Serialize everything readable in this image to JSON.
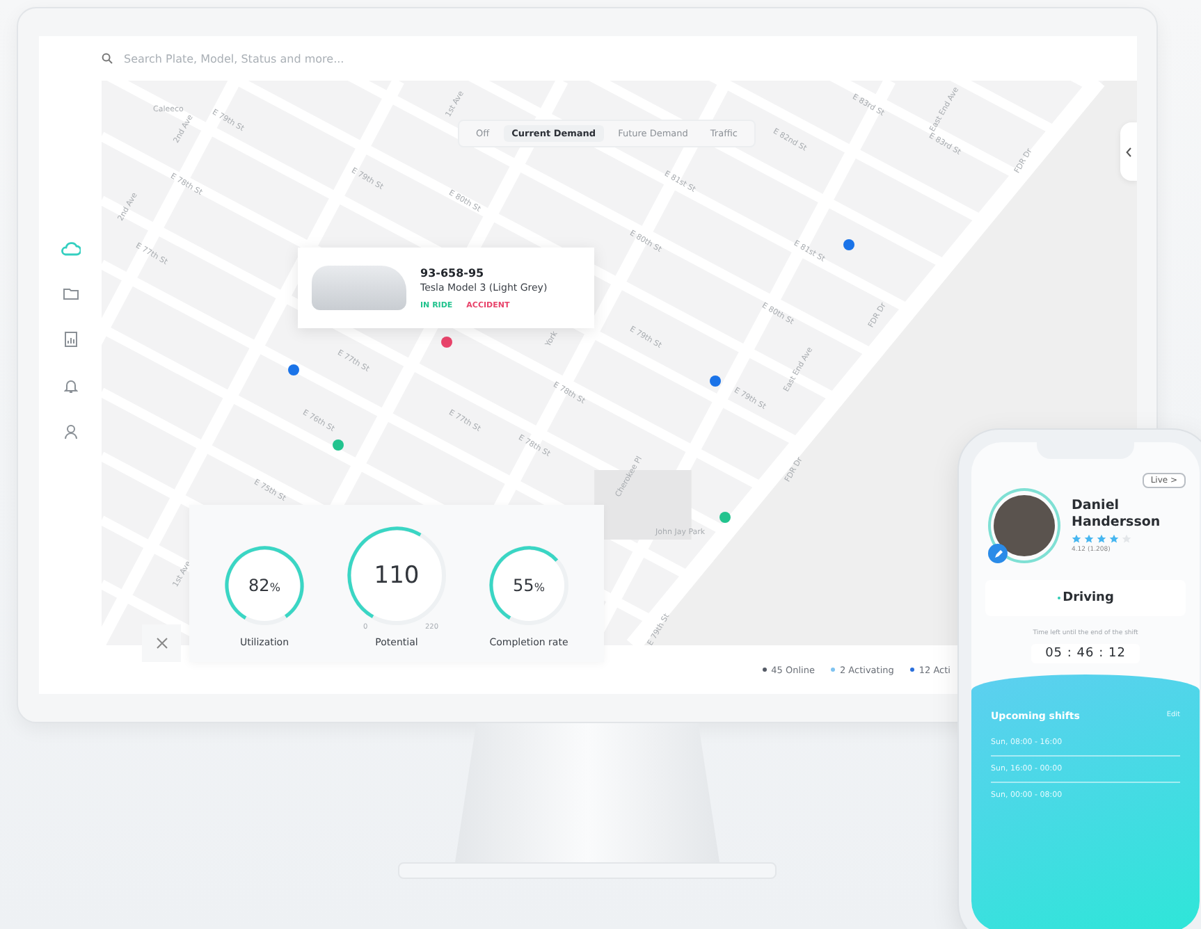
{
  "search": {
    "placeholder": "Search Plate, Model, Status and more..."
  },
  "sidebar": {
    "items": [
      {
        "kind": "cloud",
        "selected": true
      },
      {
        "kind": "folder",
        "selected": false
      },
      {
        "kind": "report",
        "selected": false
      },
      {
        "kind": "bell",
        "selected": false
      },
      {
        "kind": "user",
        "selected": false
      }
    ]
  },
  "layer_tabs": [
    {
      "label": "Off",
      "selected": false
    },
    {
      "label": "Current Demand",
      "selected": true
    },
    {
      "label": "Future Demand",
      "selected": false
    },
    {
      "label": "Traffic",
      "selected": false
    }
  ],
  "map": {
    "street_labels": [
      "Caleeco",
      "2nd Ave",
      "E 79th St",
      "E 78th St",
      "2nd Ave",
      "E 77th St",
      "1st Ave",
      "E 79th St",
      "E 80th St",
      "E 81st St",
      "E 82nd St",
      "E 83rd St",
      "East End Ave",
      "E 83rd St",
      "FDR Dr",
      "E 80th St",
      "E 81st St",
      "E 80th St",
      "E 79th St",
      "E 79th St",
      "East End Ave",
      "FDR Dr",
      "E 77th St",
      "York",
      "E 78th St",
      "E 76th St",
      "E 77th St",
      "E 78th St",
      "E 75th St",
      "1st Ave",
      "Cherokee Pl",
      "John Jay Park",
      "FDR Dr",
      "E 79th St"
    ],
    "pins": [
      {
        "color": "#e8436a"
      },
      {
        "color": "#1a73e8"
      },
      {
        "color": "#1a73e8"
      },
      {
        "color": "#1a73e8"
      },
      {
        "color": "#22c38e"
      },
      {
        "color": "#22c38e"
      }
    ]
  },
  "vehicle_popup": {
    "plate": "93-658-95",
    "model": "Tesla Model 3 (Light Grey)",
    "statuses": [
      {
        "label": "IN RIDE",
        "color": "#22c38e"
      },
      {
        "label": "ACCIDENT",
        "color": "#e8436a"
      }
    ]
  },
  "gauges": [
    {
      "value": "82",
      "unit": "%",
      "label": "Utilization",
      "level": 0.82
    },
    {
      "value": "110",
      "label": "Potential",
      "level": 0.5,
      "min": "0",
      "max": "220"
    },
    {
      "value": "55",
      "unit": "%",
      "label": "Completion rate",
      "level": 0.55
    }
  ],
  "legend": [
    {
      "label": "45 Online",
      "color": "#555b66"
    },
    {
      "label": "2 Activating",
      "color": "#7fc3f0"
    },
    {
      "label": "12 Acti",
      "color": "#2a6fdb"
    }
  ],
  "driver": {
    "live_button": "Live >",
    "name": "Daniel Handersson",
    "stars": 4,
    "rating": "4.12 (1.208)",
    "status": "Driving",
    "timer_caption": "Time left until the end of the shift",
    "timer": "05 : 46 : 12"
  },
  "shifts": {
    "title": "Upcoming shifts",
    "edit": "Edit",
    "items": [
      "Sun, 08:00 - 16:00",
      "Sun, 16:00 - 00:00",
      "Sun, 00:00 - 08:00"
    ]
  }
}
